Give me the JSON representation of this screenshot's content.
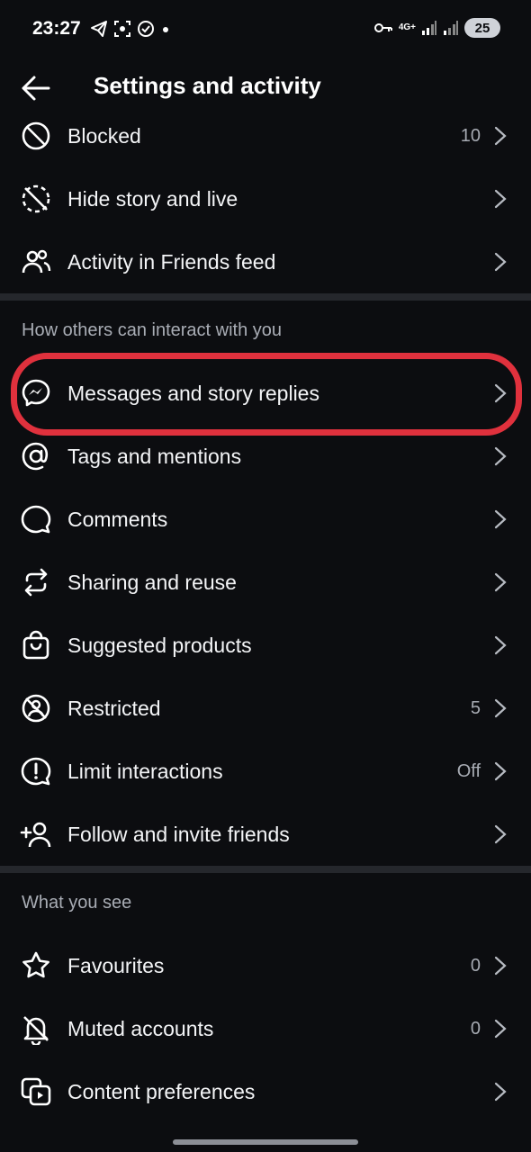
{
  "status_bar": {
    "time": "23:27",
    "network": "4G+",
    "battery": "25"
  },
  "header": {
    "title": "Settings and activity"
  },
  "group_top": [
    {
      "label": "Blocked",
      "value": "10",
      "icon": "blocked-icon"
    },
    {
      "label": "Hide story and live",
      "value": "",
      "icon": "hide-story-icon"
    },
    {
      "label": "Activity in Friends feed",
      "value": "",
      "icon": "friends-icon"
    }
  ],
  "section_interact": {
    "title": "How others can interact with you",
    "items": [
      {
        "label": "Messages and story replies",
        "value": "",
        "icon": "messenger-icon"
      },
      {
        "label": "Tags and mentions",
        "value": "",
        "icon": "at-sign-icon"
      },
      {
        "label": "Comments",
        "value": "",
        "icon": "comment-icon"
      },
      {
        "label": "Sharing and reuse",
        "value": "",
        "icon": "share-reuse-icon"
      },
      {
        "label": "Suggested products",
        "value": "",
        "icon": "shopping-bag-icon"
      },
      {
        "label": "Restricted",
        "value": "5",
        "icon": "restricted-icon"
      },
      {
        "label": "Limit interactions",
        "value": "Off",
        "icon": "limit-icon"
      },
      {
        "label": "Follow and invite friends",
        "value": "",
        "icon": "add-person-icon"
      }
    ]
  },
  "section_see": {
    "title": "What you see",
    "items": [
      {
        "label": "Favourites",
        "value": "0",
        "icon": "star-icon"
      },
      {
        "label": "Muted accounts",
        "value": "0",
        "icon": "muted-bell-icon"
      },
      {
        "label": "Content preferences",
        "value": "",
        "icon": "content-preferences-icon"
      }
    ]
  },
  "colors": {
    "background": "#0c0d10",
    "highlight": "#e0313d",
    "divider": "#25272c"
  }
}
